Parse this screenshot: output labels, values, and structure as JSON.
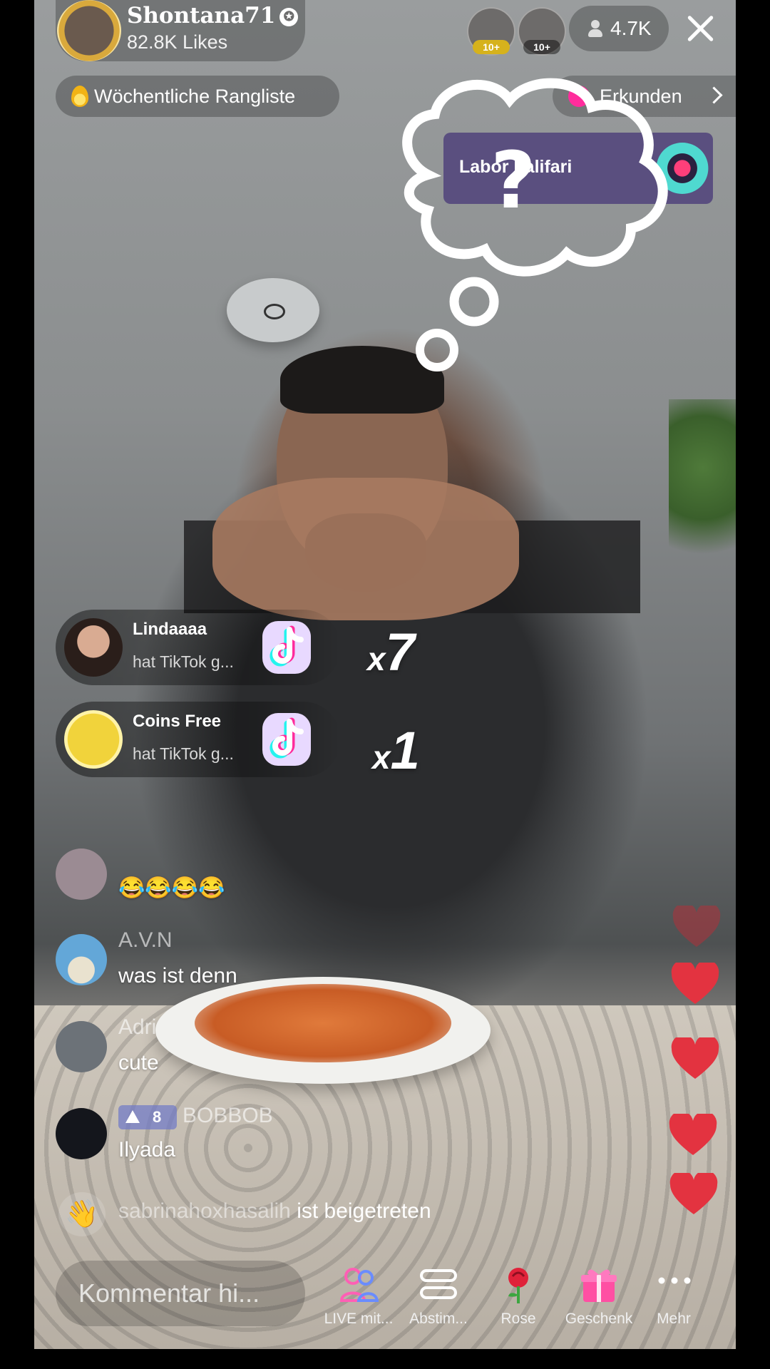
{
  "host": {
    "name": "Shontana71",
    "likes": "82.8K Likes"
  },
  "viewers": {
    "top": [
      {
        "badge": "10+"
      },
      {
        "badge": "10+"
      }
    ],
    "count": "4.7K"
  },
  "ranking_label": "Wöchentliche Rangliste",
  "explore_label": "Erkunden",
  "labor_card_title": "Labor Lalifari",
  "gifts": [
    {
      "user": "Lindaaaa",
      "text": "hat TikTok  g...",
      "count": "7"
    },
    {
      "user": "Coins  Free",
      "text": "hat TikTok  g...",
      "count": "1"
    }
  ],
  "gift_multiplier_symbol": "x",
  "comments": [
    {
      "user": "",
      "text": "😂😂😂😂"
    },
    {
      "user": "A.V.N",
      "text": "was ist denn"
    },
    {
      "user": "Adri",
      "text": "cute"
    },
    {
      "user": "BOBBOB",
      "level": "8",
      "text": "Ilyada"
    }
  ],
  "joined": {
    "user": "sabrinahoxhasalih",
    "text": "ist beigetreten"
  },
  "comment_input": {
    "placeholder": "Kommentar hi..."
  },
  "toolbar": [
    {
      "label": "LIVE mit..."
    },
    {
      "label": "Abstim..."
    },
    {
      "label": "Rose"
    },
    {
      "label": "Geschenk"
    },
    {
      "label": "Mehr"
    }
  ],
  "colors": {
    "heart": "#e33340",
    "brand_pink": "#ff2c9c",
    "tiktok_cyan": "#25f4ee"
  }
}
